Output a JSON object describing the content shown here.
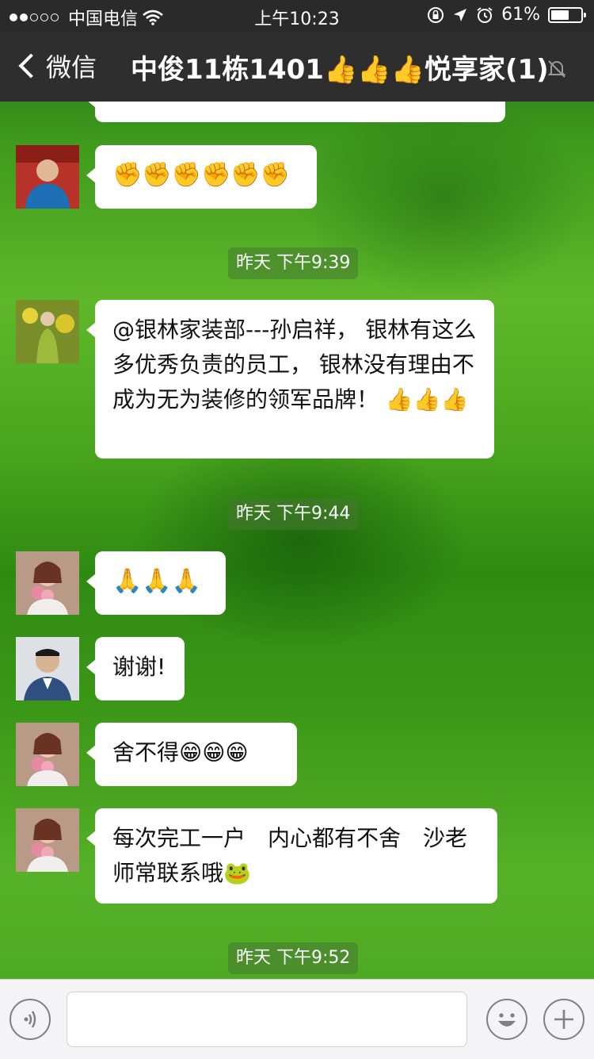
{
  "status": {
    "carrier": "中国电信",
    "time": "上午10:23",
    "battery": "61%",
    "battery_level": 0.61
  },
  "nav": {
    "back_label": "微信",
    "title": "中俊11栋1401👍👍👍悦享家(1)"
  },
  "messages": {
    "top_partial": "✊✊",
    "m1": "✊✊✊✊✊✊",
    "t1": "昨天 下午9:39",
    "m2": "@银林家装部---孙启祥， 银林有这么多优秀负责的员工， 银林没有理由不成为无为装修的领军品牌！ 👍👍👍",
    "t2": "昨天 下午9:44",
    "m3": "🙏🙏🙏",
    "m4": "谢谢!",
    "m5": "舍不得😁😁😁",
    "m6": "每次完工一户　内心都有不舍　沙老师常联系哦🐸",
    "t3": "昨天 下午9:52"
  },
  "icons": {
    "signal": "signal-dots-icon",
    "wifi": "wifi-icon",
    "lock": "rotation-lock-icon",
    "location": "location-arrow-icon",
    "alarm": "alarm-icon",
    "battery": "battery-icon",
    "back": "chevron-left-icon",
    "mute": "mute-bell-icon",
    "voice": "voice-icon",
    "emoji": "emoji-icon",
    "plus": "plus-icon"
  }
}
